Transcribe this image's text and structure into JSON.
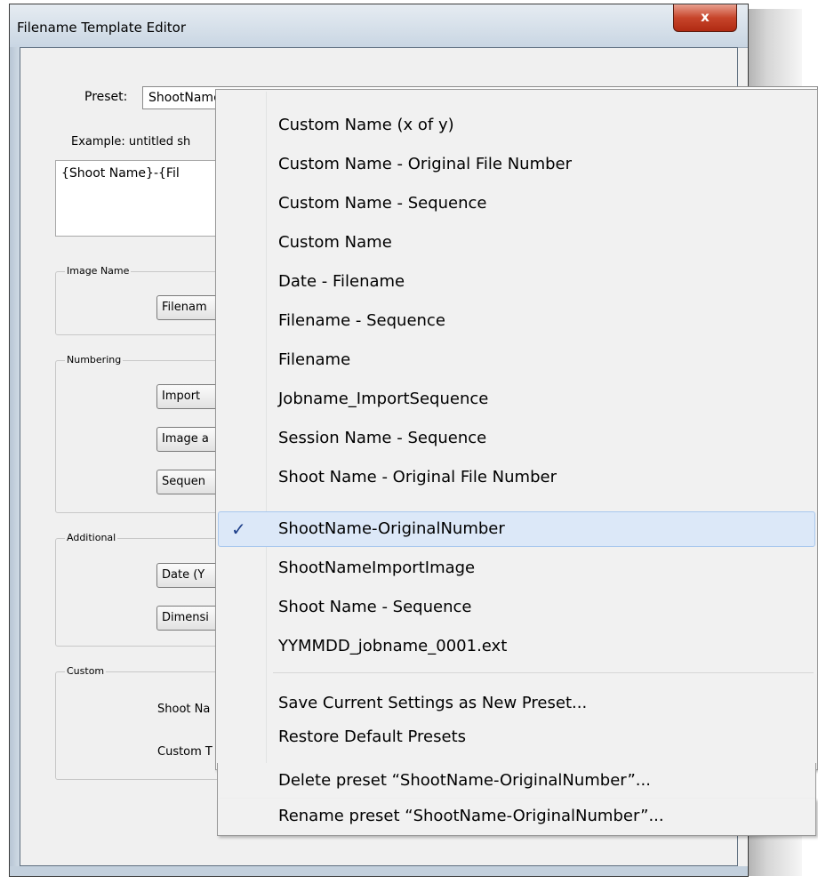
{
  "window": {
    "title": "Filename Template Editor",
    "close_glyph": "x"
  },
  "form": {
    "preset_label": "Preset:",
    "preset_value": "ShootName-OriginalNumber",
    "example_label": "Example: untitled sh",
    "template_text": "{Shoot Name}-{Fil"
  },
  "groups": {
    "image_name": {
      "label": "Image Name",
      "buttons": [
        "Filenam"
      ]
    },
    "numbering": {
      "label": "Numbering",
      "buttons": [
        "Import",
        "Image a",
        "Sequen"
      ]
    },
    "additional": {
      "label": "Additional",
      "buttons": [
        "Date (Y",
        "Dimensi"
      ]
    },
    "custom": {
      "label": "Custom",
      "fields": [
        "Shoot Na",
        "Custom T"
      ]
    }
  },
  "menu": {
    "items": [
      "Custom Name (x of y)",
      "Custom Name - Original File Number",
      "Custom Name - Sequence",
      "Custom Name",
      "Date - Filename",
      "Filename - Sequence",
      "Filename",
      "Jobname_ImportSequence",
      "Session Name - Sequence",
      "Shoot Name - Original File Number",
      "ShootName-OriginalNumber",
      "ShootNameImportImage",
      "Shoot Name - Sequence",
      "YYMMDD_jobname_0001.ext"
    ],
    "selected_item": "ShootName-OriginalNumber",
    "checkmark": "✓",
    "actions": [
      "Save Current Settings as New Preset...",
      "Restore Default Presets",
      "Delete preset “ShootName-OriginalNumber”...",
      "Rename preset “ShootName-OriginalNumber”..."
    ]
  },
  "icons": {
    "dropdown": "chevron-down-icon",
    "check": "check-icon",
    "close": "close-icon"
  },
  "colors": {
    "selection_bg": "#dce8f8",
    "close_button": "#c7452b",
    "check": "#1e3f8a"
  }
}
